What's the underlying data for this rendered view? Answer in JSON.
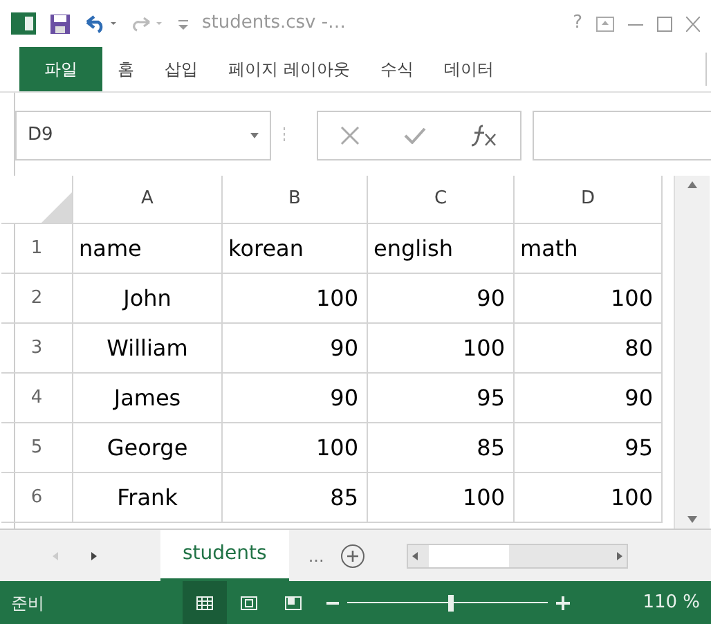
{
  "title_bar": {
    "title": "students.csv -…",
    "help": "?"
  },
  "ribbon_tabs": [
    {
      "label": "파일",
      "kind": "file"
    },
    {
      "label": "홈",
      "kind": "tab"
    },
    {
      "label": "삽입",
      "kind": "tab"
    },
    {
      "label": "페이지 레이아웃",
      "kind": "tab"
    },
    {
      "label": "수식",
      "kind": "tab"
    },
    {
      "label": "데이터",
      "kind": "tab"
    }
  ],
  "formula_bar": {
    "name_box": "D9"
  },
  "columns": [
    "A",
    "B",
    "C",
    "D"
  ],
  "rows": [
    {
      "number": "1",
      "kind": "header",
      "cells": [
        "name",
        "korean",
        "english",
        "math"
      ]
    },
    {
      "number": "2",
      "kind": "data",
      "cells": [
        "John",
        "100",
        "90",
        "100"
      ]
    },
    {
      "number": "3",
      "kind": "data",
      "cells": [
        "William",
        "90",
        "100",
        "80"
      ]
    },
    {
      "number": "4",
      "kind": "data",
      "cells": [
        "James",
        "90",
        "95",
        "90"
      ]
    },
    {
      "number": "5",
      "kind": "data",
      "cells": [
        "George",
        "100",
        "85",
        "95"
      ]
    },
    {
      "number": "6",
      "kind": "data",
      "cells": [
        "Frank",
        "85",
        "100",
        "100"
      ]
    }
  ],
  "sheet_tabs": [
    {
      "label": "students",
      "selected": true
    }
  ],
  "more_sheets": "...",
  "status_bar": {
    "status": "준비",
    "views": [
      {
        "kind": "normal",
        "selected": true
      },
      {
        "kind": "page_layout",
        "selected": false
      },
      {
        "kind": "page_break",
        "selected": false
      }
    ],
    "zoom": {
      "level": 0.52,
      "reading": "110 %"
    }
  }
}
